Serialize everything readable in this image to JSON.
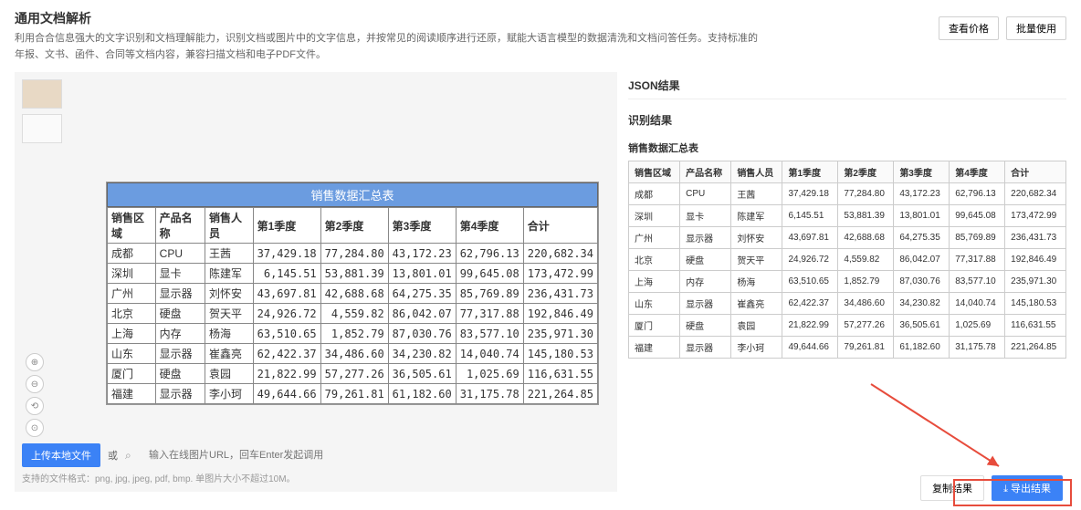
{
  "header": {
    "title": "通用文档解析",
    "desc": "利用合合信息强大的文字识别和文档理解能力，识别文档或图片中的文字信息，并按常见的阅读顺序进行还原，赋能大语言模型的数据清洗和文档问答任务。支持标准的年报、文书、函件、合同等文档内容，兼容扫描文档和电子PDF文件。",
    "price_btn": "查看价格",
    "batch_btn": "批量使用"
  },
  "preview": {
    "caption": "销售数据汇总表",
    "headers": [
      "销售区域",
      "产品名称",
      "销售人员",
      "第1季度",
      "第2季度",
      "第3季度",
      "第4季度",
      "合计"
    ],
    "rows": [
      [
        "成都",
        "CPU",
        "王茜",
        "37,429.18",
        "77,284.80",
        "43,172.23",
        "62,796.13",
        "220,682.34"
      ],
      [
        "深圳",
        "显卡",
        "陈建军",
        "6,145.51",
        "53,881.39",
        "13,801.01",
        "99,645.08",
        "173,472.99"
      ],
      [
        "广州",
        "显示器",
        "刘怀安",
        "43,697.81",
        "42,688.68",
        "64,275.35",
        "85,769.89",
        "236,431.73"
      ],
      [
        "北京",
        "硬盘",
        "贺天平",
        "24,926.72",
        "4,559.82",
        "86,042.07",
        "77,317.88",
        "192,846.49"
      ],
      [
        "上海",
        "内存",
        "杨海",
        "63,510.65",
        "1,852.79",
        "87,030.76",
        "83,577.10",
        "235,971.30"
      ],
      [
        "山东",
        "显示器",
        "崔鑫亮",
        "62,422.37",
        "34,486.60",
        "34,230.82",
        "14,040.74",
        "145,180.53"
      ],
      [
        "厦门",
        "硬盘",
        "袁园",
        "21,822.99",
        "57,277.26",
        "36,505.61",
        "1,025.69",
        "116,631.55"
      ],
      [
        "福建",
        "显示器",
        "李小珂",
        "49,644.66",
        "79,261.81",
        "61,182.60",
        "31,175.78",
        "221,264.85"
      ]
    ]
  },
  "upload": {
    "btn": "上传本地文件",
    "or": "或",
    "placeholder": "输入在线图片URL，回车Enter发起调用",
    "hint": "支持的文件格式：png, jpg, jpeg, pdf, bmp. 单图片大小不超过10M。"
  },
  "json_panel": {
    "title": "JSON结果",
    "subtitle": "识别结果",
    "caption": "销售数据汇总表",
    "headers": [
      "销售区域",
      "产品名称",
      "销售人员",
      "第1季度",
      "第2季度",
      "第3季度",
      "第4季度",
      "合计"
    ],
    "rows": [
      [
        "成都",
        "CPU",
        "王茜",
        "37,429.18",
        "77,284.80",
        "43,172.23",
        "62,796.13",
        "220,682.34"
      ],
      [
        "深圳",
        "显卡",
        "陈建军",
        "6,145.51",
        "53,881.39",
        "13,801.01",
        "99,645.08",
        "173,472.99"
      ],
      [
        "广州",
        "显示器",
        "刘怀安",
        "43,697.81",
        "42,688.68",
        "64,275.35",
        "85,769.89",
        "236,431.73"
      ],
      [
        "北京",
        "硬盘",
        "贺天平",
        "24,926.72",
        "4,559.82",
        "86,042.07",
        "77,317.88",
        "192,846.49"
      ],
      [
        "上海",
        "内存",
        "杨海",
        "63,510.65",
        "1,852.79",
        "87,030.76",
        "83,577.10",
        "235,971.30"
      ],
      [
        "山东",
        "显示器",
        "崔鑫亮",
        "62,422.37",
        "34,486.60",
        "34,230.82",
        "14,040.74",
        "145,180.53"
      ],
      [
        "厦门",
        "硬盘",
        "袁园",
        "21,822.99",
        "57,277.26",
        "36,505.61",
        "1,025.69",
        "116,631.55"
      ],
      [
        "福建",
        "显示器",
        "李小珂",
        "49,644.66",
        "79,261.81",
        "61,182.60",
        "31,175.78",
        "221,264.85"
      ]
    ]
  },
  "footer": {
    "copy": "复制结果",
    "export": "导出结果"
  },
  "icons": {
    "zoom_in": "⊕",
    "zoom_out": "⊖",
    "reset1": "⟲",
    "reset2": "⊙",
    "search": "⌕",
    "download": "⤓"
  }
}
